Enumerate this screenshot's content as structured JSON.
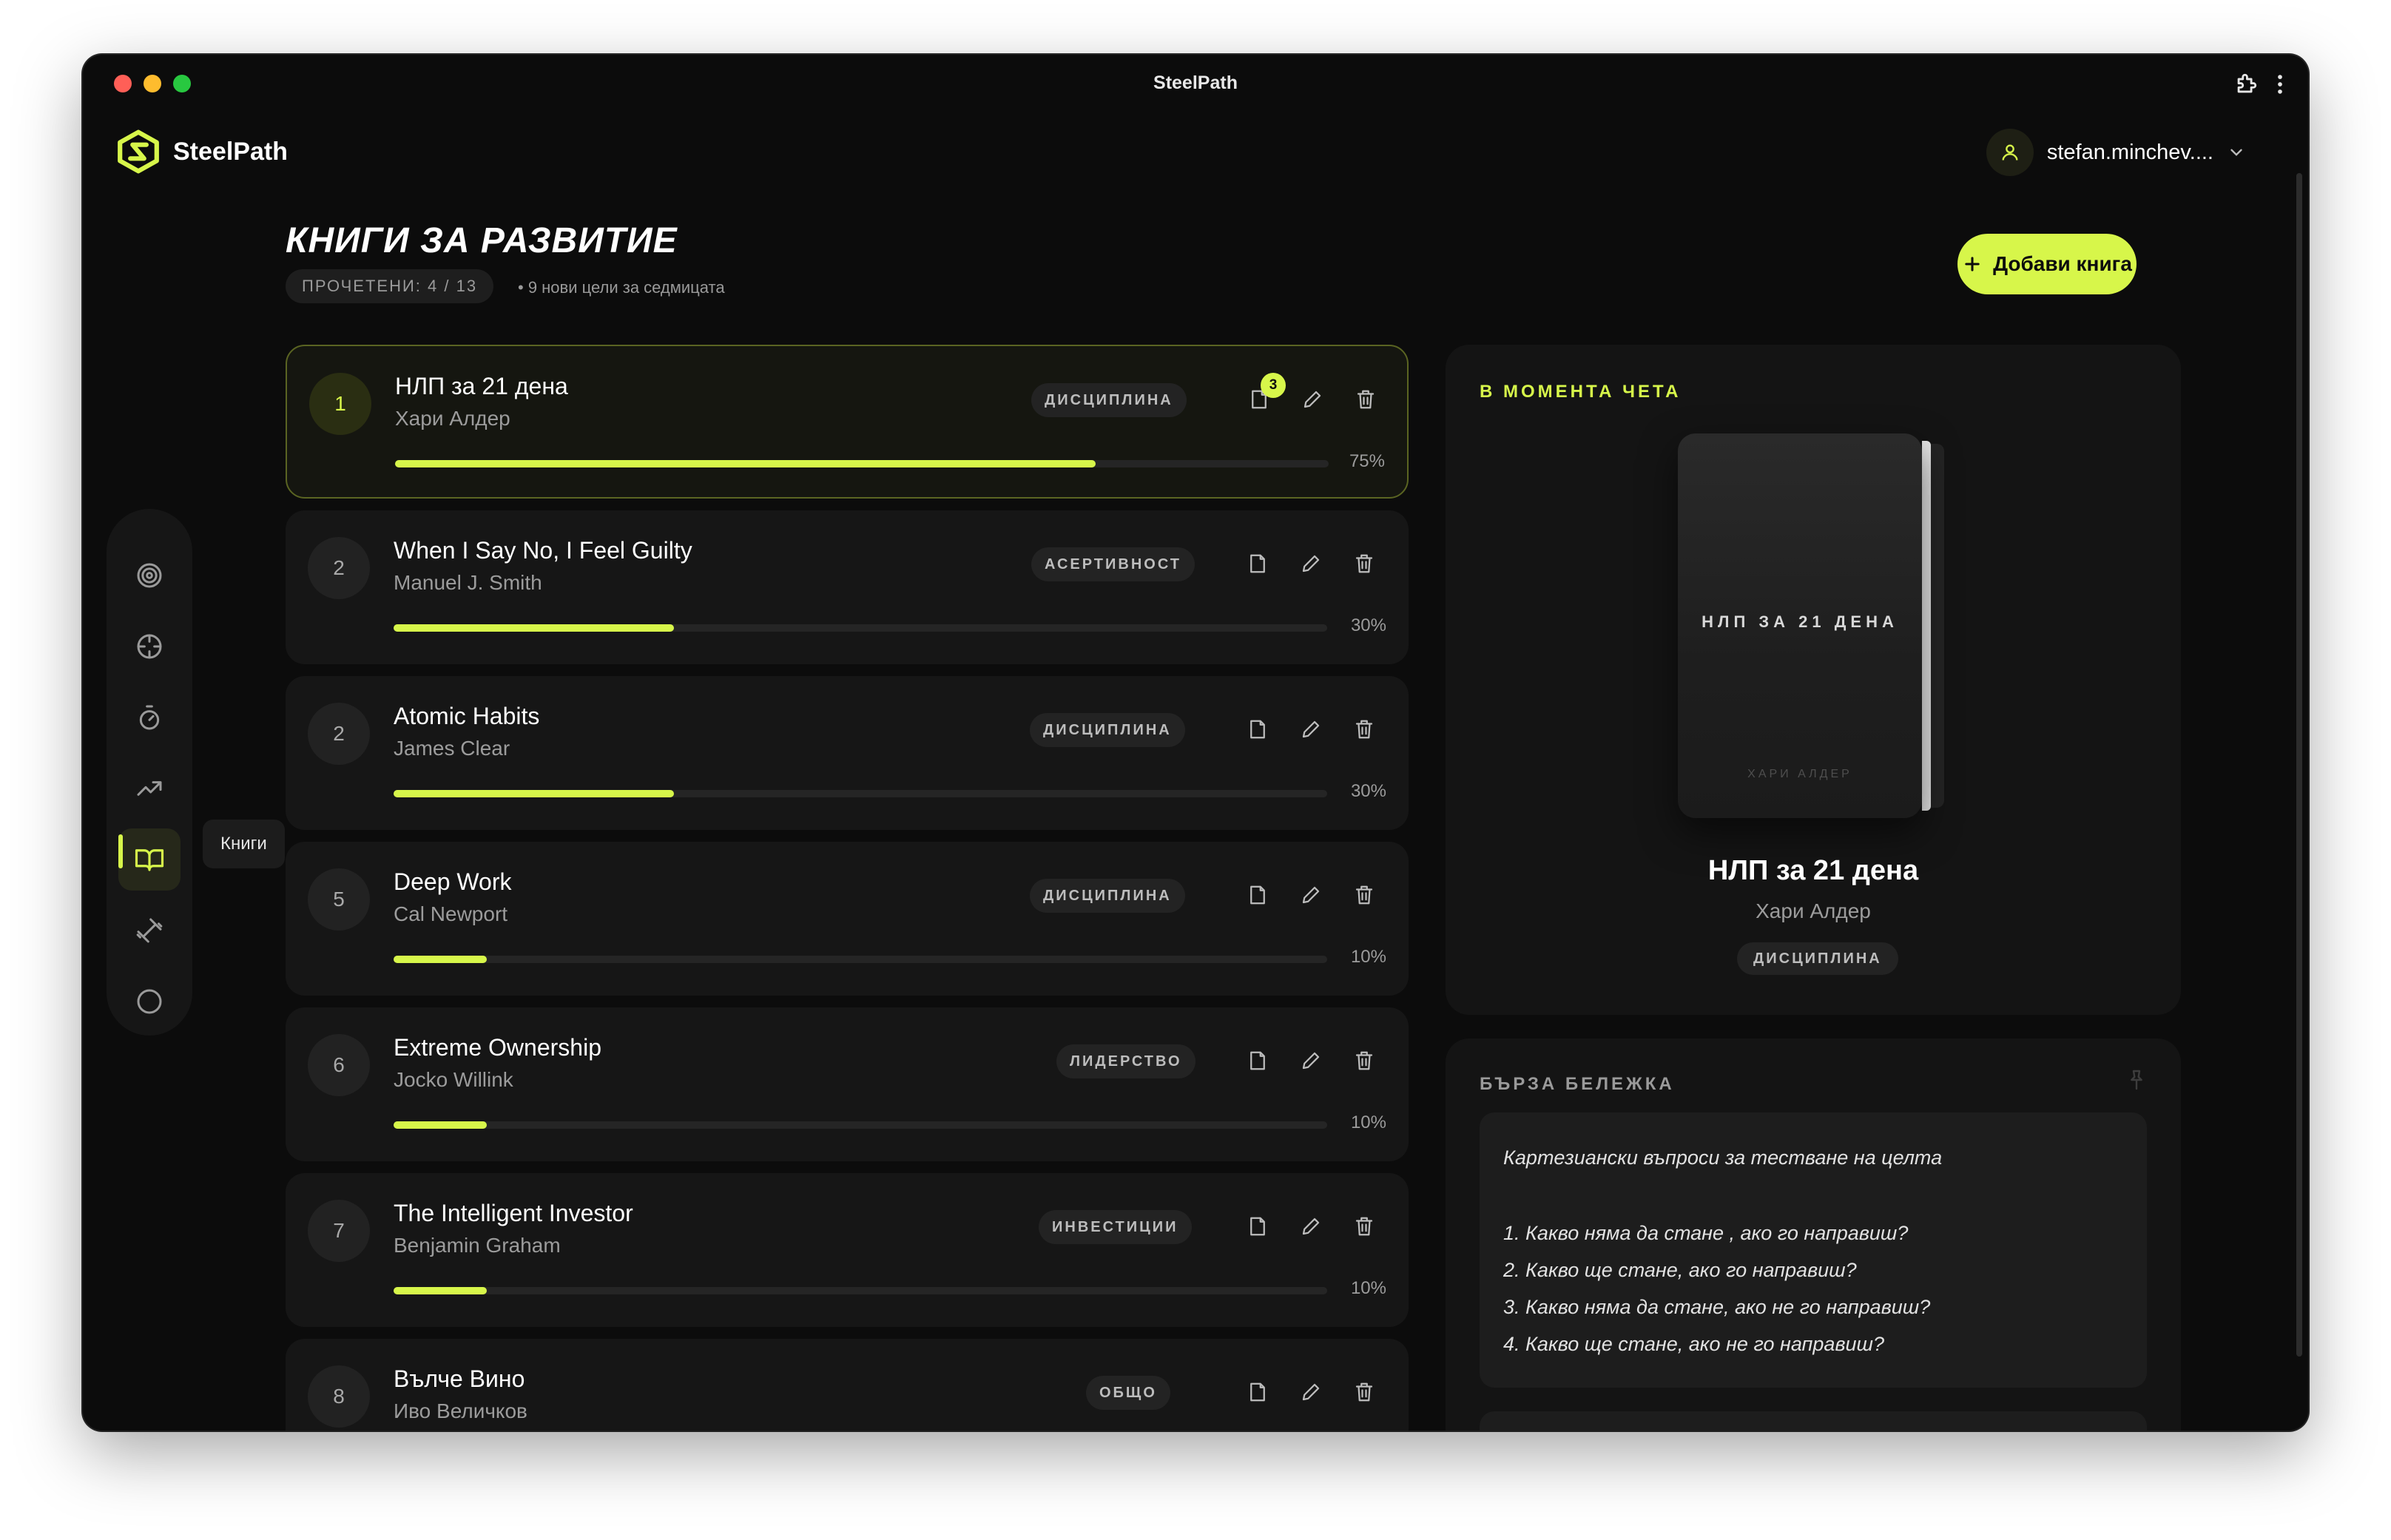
{
  "window": {
    "title": "SteelPath"
  },
  "brand": {
    "name": "SteelPath"
  },
  "user": {
    "name": "stefan.minchev...."
  },
  "page": {
    "title": "КНИГИ ЗА РАЗВИТИЕ",
    "counter": "ПРОЧЕТЕНИ: 4 / 13",
    "subtitle": "• 9 нови цели за седмицата",
    "add_button": "Добави книга"
  },
  "sidebar": {
    "items": [
      {
        "icon": "target-icon",
        "label": ""
      },
      {
        "icon": "crosshair-icon",
        "label": ""
      },
      {
        "icon": "stopwatch-icon",
        "label": ""
      },
      {
        "icon": "trending-up-icon",
        "label": ""
      },
      {
        "icon": "book-open-icon",
        "label": "Книги",
        "active": true
      },
      {
        "icon": "dumbbell-icon",
        "label": ""
      },
      {
        "icon": "circle-icon",
        "label": ""
      }
    ],
    "tooltip": "Книги"
  },
  "books": [
    {
      "num": "1",
      "title": "НЛП за 21 дена",
      "author": "Хари Алдер",
      "tag": "ДИСЦИПЛИНА",
      "progress": 75,
      "pct": "75%",
      "notes": "3",
      "active": true
    },
    {
      "num": "2",
      "title": "When I Say No, I Feel Guilty",
      "author": "Manuel J. Smith",
      "tag": "АСЕРТИВНОСТ",
      "progress": 30,
      "pct": "30%"
    },
    {
      "num": "2",
      "title": "Atomic Habits",
      "author": "James Clear",
      "tag": "ДИСЦИПЛИНА",
      "progress": 30,
      "pct": "30%"
    },
    {
      "num": "5",
      "title": "Deep Work",
      "author": "Cal Newport",
      "tag": "ДИСЦИПЛИНА",
      "progress": 10,
      "pct": "10%"
    },
    {
      "num": "6",
      "title": "Extreme Ownership",
      "author": "Jocko Willink",
      "tag": "ЛИДЕРСТВО",
      "progress": 10,
      "pct": "10%"
    },
    {
      "num": "7",
      "title": "The Intelligent Investor",
      "author": "Benjamin Graham",
      "tag": "ИНВЕСТИЦИИ",
      "progress": 10,
      "pct": "10%"
    },
    {
      "num": "8",
      "title": "Вълче Вино",
      "author": "Иво Величков",
      "tag": "ОБЩО"
    }
  ],
  "now_reading": {
    "label": "В МОМЕНТА ЧЕТА",
    "cover_title": "НЛП ЗА 21 ДЕНА",
    "cover_author": "ХАРИ АЛДЕР",
    "title": "НЛП за 21 дена",
    "author": "Хари Алдер",
    "tag": "ДИСЦИПЛИНА"
  },
  "quick_note": {
    "label": "БЪРЗА БЕЛЕЖКА",
    "lines": [
      "Картезиански въпроси за тестване на целта",
      "1. Какво няма да стане , ако го направиш?",
      "2. Какво ще стане, ако го направиш?",
      "3. Какво няма да стане, ако не го направиш?",
      "4. Какво ще стане, ако не го направиш?"
    ]
  },
  "colors": {
    "accent": "#d7f64a",
    "background": "#0c0c0c",
    "card": "#161616"
  }
}
